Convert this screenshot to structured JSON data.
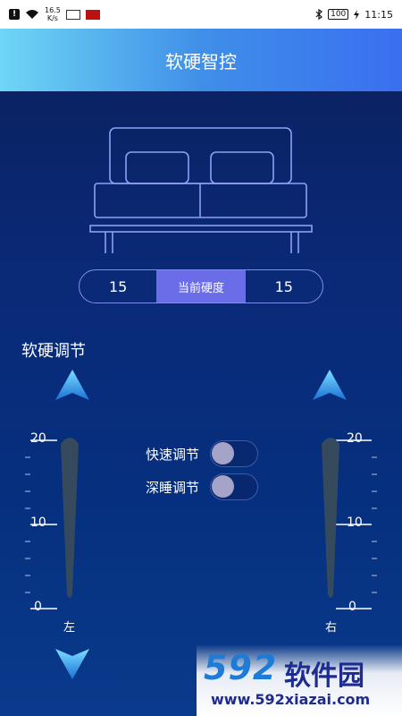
{
  "status": {
    "speed_top": "16.5",
    "speed_bottom": "K/s",
    "battery": "100",
    "time": "11:15"
  },
  "header": {
    "title": "软硬智控"
  },
  "hardness": {
    "left_value": "15",
    "label": "当前硬度",
    "right_value": "15"
  },
  "section": {
    "title": "软硬调节"
  },
  "scale": {
    "ticks": [
      "20",
      "10",
      "0"
    ],
    "left_side": "左",
    "right_side": "右",
    "left_level": 0.0,
    "right_level": 0.0
  },
  "toggles": [
    {
      "label": "快速调节",
      "on": false
    },
    {
      "label": "深睡调节",
      "on": false
    }
  ],
  "watermark": {
    "brand_num": "592",
    "brand_cn": "软件园",
    "url": "www.592xiazai.com"
  },
  "colors": {
    "accent": "#6b6de8",
    "header_start": "#6fd6f5",
    "header_end": "#3a6ff0",
    "arrow": "#2aa6ee"
  }
}
